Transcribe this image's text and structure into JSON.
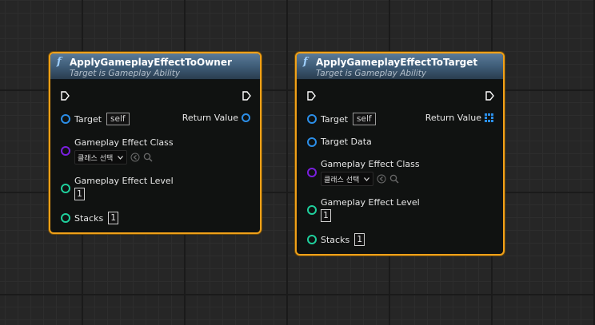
{
  "nodes": [
    {
      "title": "ApplyGameplayEffectToOwner",
      "subtitle": "Target is Gameplay Ability",
      "function_icon": "f",
      "target_label": "Target",
      "target_value": "self",
      "return_label": "Return Value",
      "effect_class_label": "Gameplay Effect Class",
      "effect_class_value": "클래스 선택",
      "effect_level_label": "Gameplay Effect Level",
      "effect_level_value": "1",
      "stacks_label": "Stacks",
      "stacks_value": "1"
    },
    {
      "title": "ApplyGameplayEffectToTarget",
      "subtitle": "Target is Gameplay Ability",
      "function_icon": "f",
      "target_label": "Target",
      "target_value": "self",
      "return_label": "Return Value",
      "target_data_label": "Target Data",
      "effect_class_label": "Gameplay Effect Class",
      "effect_class_value": "클래스 선택",
      "effect_level_label": "Gameplay Effect Level",
      "effect_level_value": "1",
      "stacks_label": "Stacks",
      "stacks_value": "1"
    }
  ],
  "colors": {
    "selection_border": "#f0a019",
    "object_pin": "#2b8ee8",
    "class_pin": "#7a1fe0",
    "numeric_pin": "#1fcf9c"
  }
}
